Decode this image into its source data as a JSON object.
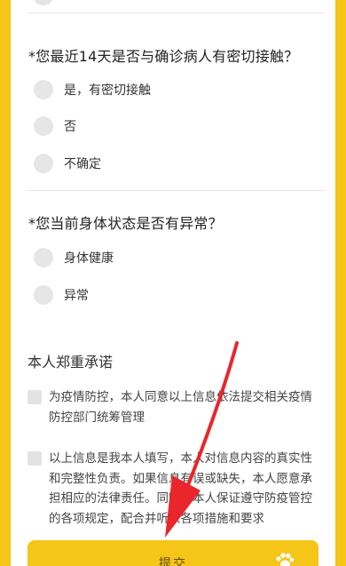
{
  "questions": [
    {
      "text": "*您最近14天是否与确诊病人有密切接触？",
      "options": [
        "是，有密切接触",
        "否",
        "不确定"
      ]
    },
    {
      "text": "*您当前身体状态是否有异常？",
      "options": [
        "身体健康",
        "异常"
      ]
    }
  ],
  "commitment": {
    "title": "本人郑重承诺",
    "items": [
      "为疫情防控，本人同意以上信息依法提交相关疫情防控部门统筹管理",
      "以上信息是我本人填写，本人对信息内容的真实性和完整性负责。如果信息有误或缺失，本人愿意承担相应的法律责任。同时，本人保证遵守防疫管控的各项规定，配合并听从各项措施和要求"
    ]
  },
  "submit_label": "提交",
  "colors": {
    "brand_yellow": "#F5C518",
    "annotation_red": "#E8262B"
  },
  "icons": {
    "radio": "radio-unchecked-icon",
    "checkbox": "checkbox-unchecked-icon",
    "paw": "paw-icon",
    "arrow": "red-arrow-annotation"
  }
}
